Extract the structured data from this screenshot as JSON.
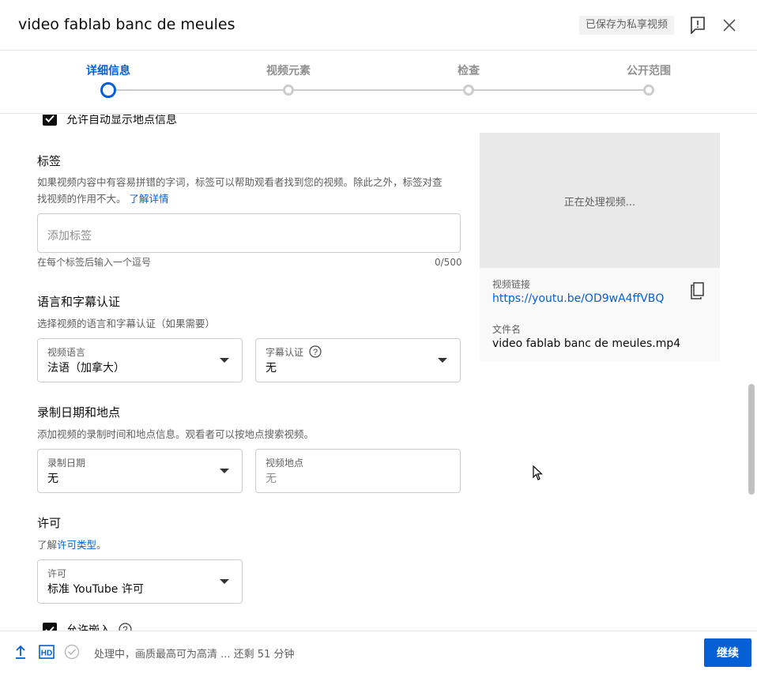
{
  "header": {
    "title": "video fablab banc de meules",
    "saved_badge": "已保存为私享视频"
  },
  "stepper": {
    "steps": [
      {
        "label": "详细信息",
        "active": true
      },
      {
        "label": "视频元素",
        "active": false
      },
      {
        "label": "检查",
        "active": false
      },
      {
        "label": "公开范围",
        "active": false
      }
    ]
  },
  "location_checkbox": {
    "label": "允许自动显示地点信息",
    "checked": true
  },
  "tags": {
    "title": "标签",
    "description": "如果视频内容中有容易拼错的字词，标签可以帮助观看者找到您的视频。除此之外，标签对查",
    "description2": "找视频的作用不大。",
    "learn_more": "了解详情",
    "placeholder": "添加标签",
    "hint": "在每个标签后输入一个逗号",
    "counter": "0/500"
  },
  "language": {
    "title": "语言和字幕认证",
    "description": "选择视频的语言和字幕认证（如果需要）",
    "video_language_label": "视频语言",
    "video_language_value": "法语（加拿大）",
    "caption_cert_label": "字幕认证",
    "caption_cert_value": "无"
  },
  "recording": {
    "title": "录制日期和地点",
    "description": "添加视频的录制时间和地点信息。观看者可以按地点搜索视频。",
    "date_label": "录制日期",
    "date_value": "无",
    "location_label": "视频地点",
    "location_placeholder": "无"
  },
  "license": {
    "title": "许可",
    "desc_prefix": "了解",
    "desc_link": "许可类型",
    "desc_suffix": "。",
    "field_label": "许可",
    "field_value": "标准 YouTube 许可"
  },
  "embed_checkbox": {
    "label": "允许嵌入",
    "checked": true
  },
  "video_card": {
    "processing": "正在处理视频...",
    "link_label": "视频链接",
    "link_value": "https://youtu.be/OD9wA4ffVBQ",
    "filename_label": "文件名",
    "filename_value": "video fablab banc de meules.mp4"
  },
  "footer": {
    "status": "处理中，画质最高可为高清 ... 还剩 51 分钟",
    "hd": "HD",
    "continue": "继续"
  },
  "colors": {
    "accent": "#065fd4",
    "inactive": "#cccccc"
  }
}
